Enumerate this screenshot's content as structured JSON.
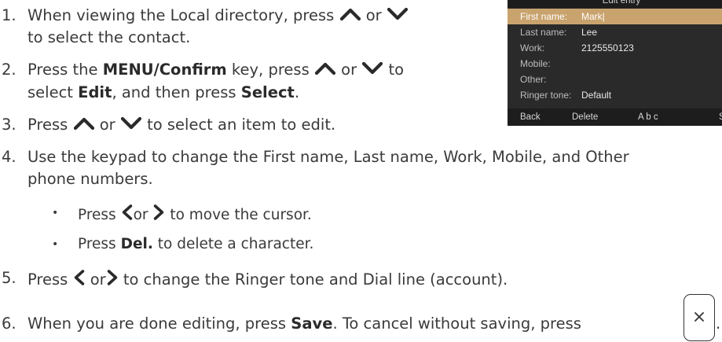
{
  "steps": [
    {
      "number": "1.",
      "line1_a": "When viewing the Local directory, press",
      "line1_b": "or",
      "line2": "to select the contact."
    },
    {
      "number": "2.",
      "line1_a": "Press the",
      "line1_bold": "MENU/Confirm",
      "line1_b": "key, press",
      "line1_c": "or",
      "line1_d": "to",
      "line2_a": "select",
      "line2_bold1": "Edit",
      "line2_b": ", and then press",
      "line2_bold2": "Select",
      "line2_c": "."
    },
    {
      "number": "3.",
      "text_a": "Press",
      "text_b": "or",
      "text_c": "to select an item to edit."
    },
    {
      "number": "4.",
      "line1": "Use the keypad to change the First name, Last name, Work, Mobile, and Other",
      "line2": "phone numbers."
    },
    {
      "number": "5.",
      "text_a": "Press",
      "text_b": "or",
      "text_c": "to change the Ringer tone and Dial line (account)."
    },
    {
      "number": "6.",
      "text_a": "When you are done editing, press",
      "text_bold": "Save",
      "text_b": ". To cancel without saving, press",
      "text_c": "."
    }
  ],
  "sub_bullets": [
    {
      "text_a": "Press",
      "text_b": "or",
      "text_c": "to move the cursor."
    },
    {
      "text_a": "Press",
      "text_bold": "Del.",
      "text_b": "to delete a character."
    }
  ],
  "bullet_glyph": "•",
  "screen": {
    "title": "Edit entry",
    "fields": [
      {
        "label": "First name:",
        "value": "Mark|",
        "selected": true
      },
      {
        "label": "Last name:",
        "value": "Lee"
      },
      {
        "label": "Work:",
        "value": "2125550123"
      },
      {
        "label": "Mobile:",
        "value": ""
      },
      {
        "label": "Other:",
        "value": ""
      },
      {
        "label": "Ringer tone:",
        "value": "Default"
      }
    ],
    "softkeys": [
      "Back",
      "Delete",
      "A b c",
      "S"
    ]
  },
  "icons": {
    "up": "chevron-up-icon",
    "down": "chevron-down-icon",
    "left": "chevron-left-icon",
    "right": "chevron-right-icon",
    "close": "close-x-icon"
  },
  "colors": {
    "text": "#3a3a3a",
    "screen_bg": "#2a2a2a",
    "selection": "#c9a36e"
  }
}
